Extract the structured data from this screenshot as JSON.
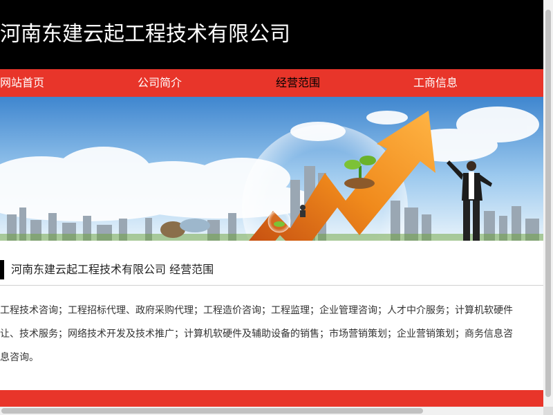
{
  "header": {
    "site_title": "河南东建云起工程技术有限公司"
  },
  "nav": {
    "items": [
      {
        "label": "网站首页",
        "active": false
      },
      {
        "label": "公司简介",
        "active": false
      },
      {
        "label": "经营范围",
        "active": true
      },
      {
        "label": "工商信息",
        "active": false
      }
    ]
  },
  "section": {
    "title": "河南东建云起工程技术有限公司 经营范围",
    "scope_lines": [
      "工程技术咨询；工程招标代理、政府采购代理；工程造价咨询；工程监理；企业管理咨询；人才中介服务；计算机软硬件",
      "让、技术服务；网络技术开发及技术推广；计算机软硬件及辅助设备的销售；市场营销策划；企业营销策划；商务信息咨",
      "息咨询。"
    ]
  },
  "colors": {
    "header_bg": "#000000",
    "nav_bg": "#e8352a",
    "accent": "#e8352a"
  },
  "icons": {
    "banner": "business-growth-arrow-banner"
  }
}
